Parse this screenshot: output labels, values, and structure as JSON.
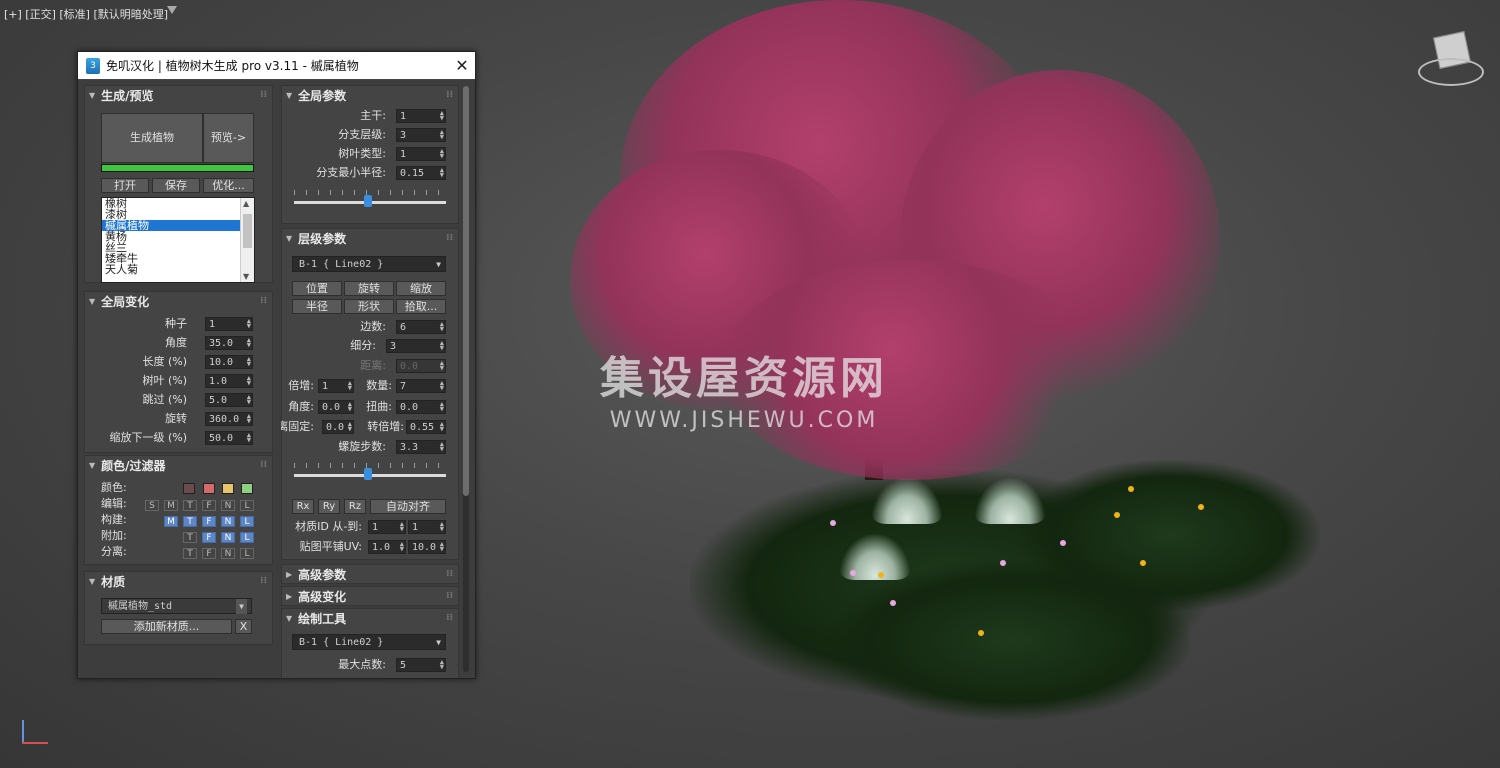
{
  "viewport": {
    "label": "[+] [正交] [标准] [默认明暗处理]"
  },
  "watermark": {
    "cn": "集设屋资源网",
    "url": "WWW.JISHEWU.COM"
  },
  "dialog": {
    "title": "免叽汉化 | 植物树木生成 pro v3.11 - 槭属植物",
    "close": "✕",
    "app_icon": "3"
  },
  "generate": {
    "heading": "生成/预览",
    "generate_btn": "生成植物",
    "preview_btn": "预览->",
    "progress": 1.0,
    "open_btn": "打开",
    "save_btn": "保存",
    "optimize_btn": "优化...",
    "list": [
      "橡树",
      "漆树",
      "槭属植物",
      "黄杨",
      "丝兰",
      "矮牵牛",
      "天人菊"
    ],
    "selected": "槭属植物"
  },
  "global_var": {
    "heading": "全局变化",
    "rows": [
      {
        "label": "种子",
        "value": "1"
      },
      {
        "label": "角度",
        "value": "35.0"
      },
      {
        "label": "长度 (%)",
        "value": "10.0"
      },
      {
        "label": "树叶 (%)",
        "value": "1.0"
      },
      {
        "label": "跳过 (%)",
        "value": "5.0"
      },
      {
        "label": "旋转",
        "value": "360.0"
      },
      {
        "label": "缩放下一级 (%)",
        "value": "50.0"
      }
    ]
  },
  "color_filter": {
    "heading": "颜色/过滤器",
    "color_label": "颜色:",
    "swatches": [
      "#6b4b4b",
      "#d46b6b",
      "#e8c36a",
      "#8fd07e"
    ],
    "edit_label": "编辑:",
    "build_label": "构建:",
    "attach_label": "附加:",
    "split_label": "分离:",
    "chips": [
      "S",
      "M",
      "T",
      "F",
      "N",
      "L"
    ]
  },
  "material": {
    "heading": "材质",
    "value": "槭属植物_std",
    "add_btn": "添加新材质...",
    "x_btn": "X"
  },
  "global_params": {
    "heading": "全局参数",
    "rows": [
      {
        "label": "主干:",
        "value": "1"
      },
      {
        "label": "分支层级:",
        "value": "3"
      },
      {
        "label": "树叶类型:",
        "value": "1"
      },
      {
        "label": "分支最小半径:",
        "value": "0.15"
      }
    ],
    "slider": 0.5
  },
  "level_params": {
    "heading": "层级参数",
    "dropdown": "B-1  { Line02 }",
    "btns_row1": [
      "位置",
      "旋转",
      "缩放"
    ],
    "btns_row2": [
      "半径",
      "形状",
      "拾取..."
    ],
    "sides_label": "边数:",
    "sides": "6",
    "subdiv_label": "细分:",
    "subdiv": "3",
    "dist_label": "距离:",
    "dist": "0.0",
    "mult_label": "倍增:",
    "mult": "1",
    "count_label": "数量:",
    "count": "7",
    "angle_label": "角度:",
    "angle": "0.0",
    "twist_label": "扭曲:",
    "twist": "0.0",
    "fixed_label": "离固定:",
    "fixed": "0.0",
    "rotmult_label": "转倍增:",
    "rotmult": "0.55",
    "helix_label": "螺旋步数:",
    "helix": "3.3",
    "slider": 0.5,
    "rx": "Rx",
    "ry": "Ry",
    "rz": "Rz",
    "auto_align": "自动对齐",
    "matid_label": "材质ID 从-到:",
    "matid_from": "1",
    "matid_to": "1",
    "uv_label": "贴图平铺UV:",
    "uv_u": "1.0",
    "uv_v": "10.0"
  },
  "advanced_params": {
    "heading": "高级参数"
  },
  "advanced_var": {
    "heading": "高级变化"
  },
  "draw_tools": {
    "heading": "绘制工具",
    "dropdown": "B-1  { Line02 }",
    "max_label": "最大点数:",
    "max_value": "5"
  }
}
